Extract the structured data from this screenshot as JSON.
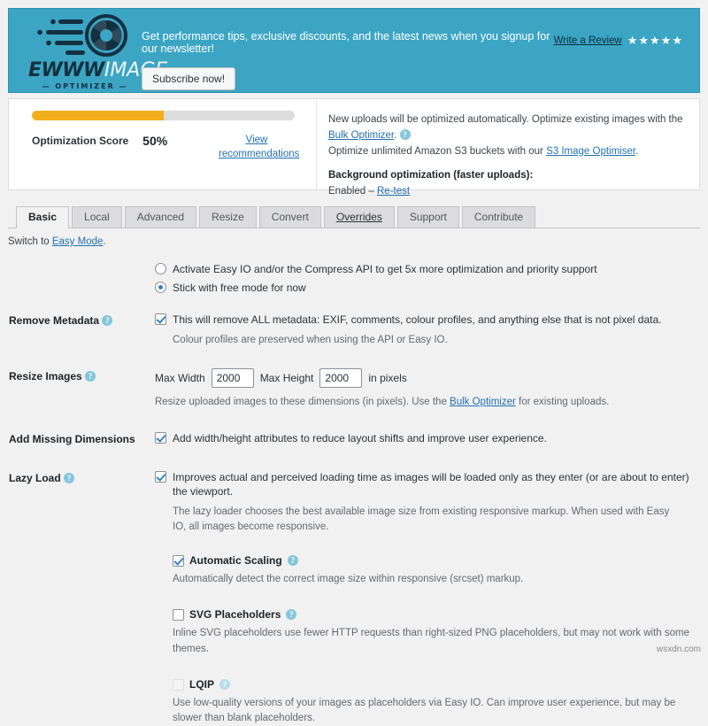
{
  "banner": {
    "logo": {
      "brand_primary": "EWWW",
      "brand_secondary": "IMAGE",
      "brand_sub": "— OPTIMIZER —"
    },
    "promo_text": "Get performance tips, exclusive discounts, and the latest news when you signup for our newsletter!",
    "subscribe_label": "Subscribe now!",
    "review_label": "Write a Review",
    "stars": "★★★★★",
    "bg_color": "#3ca5c4"
  },
  "status": {
    "progress_percent": 50,
    "score_label": "Optimization Score",
    "score_value": "50%",
    "recommendations_label": "View recommendations",
    "info_line1_a": "New uploads will be optimized automatically. Optimize existing images with the ",
    "info_line1_link": "Bulk Optimizer",
    "info_line2_a": "Optimize unlimited Amazon S3 buckets with our ",
    "info_line2_link": "S3 Image Optimiser",
    "info_line2_b": ".",
    "background_title": "Background optimization (faster uploads):",
    "background_status": "Enabled – ",
    "background_link": "Re-test",
    "progress_color": "#f2ae1c"
  },
  "tabs": [
    {
      "label": "Basic",
      "active": true
    },
    {
      "label": "Local",
      "active": false
    },
    {
      "label": "Advanced",
      "active": false
    },
    {
      "label": "Resize",
      "active": false
    },
    {
      "label": "Convert",
      "active": false
    },
    {
      "label": "Overrides",
      "active": false
    },
    {
      "label": "Support",
      "active": false
    },
    {
      "label": "Contribute",
      "active": false
    }
  ],
  "switch_mode": {
    "prefix": "Switch to ",
    "link": "Easy Mode",
    "suffix": "."
  },
  "settings": {
    "mode": {
      "option_paid": "Activate Easy IO and/or the Compress API to get 5x more optimization and priority support",
      "option_free": "Stick with free mode for now",
      "selected": "free"
    },
    "remove_metadata": {
      "label": "Remove Metadata",
      "checkbox_text": "This will remove ALL metadata: EXIF, comments, colour profiles, and anything else that is not pixel data.",
      "desc": "Colour profiles are preserved when using the API or Easy IO.",
      "checked": true
    },
    "resize_images": {
      "label": "Resize Images",
      "max_width_label": "Max Width",
      "max_width_value": "2000",
      "max_height_label": "Max Height",
      "max_height_value": "2000",
      "units": "in pixels",
      "desc_a": "Resize uploaded images to these dimensions (in pixels). Use the ",
      "desc_link": "Bulk Optimizer",
      "desc_b": " for existing uploads."
    },
    "add_missing_dimensions": {
      "label": "Add Missing Dimensions",
      "checkbox_text": "Add width/height attributes to reduce layout shifts and improve user experience.",
      "checked": true
    },
    "lazy_load": {
      "label": "Lazy Load",
      "checkbox_text": "Improves actual and perceived loading time as images will be loaded only as they enter (or are about to enter) the viewport.",
      "desc": "The lazy loader chooses the best available image size from existing responsive markup. When used with Easy IO, all images become responsive.",
      "checked": true,
      "sub_options": [
        {
          "title": "Automatic Scaling",
          "desc": "Automatically detect the correct image size within responsive (srcset) markup.",
          "checked": true,
          "disabled": false
        },
        {
          "title": "SVG Placeholders",
          "desc": "Inline SVG placeholders use fewer HTTP requests than right-sized PNG placeholders, but may not work with some themes.",
          "checked": false,
          "disabled": false
        },
        {
          "title": "LQIP",
          "desc": "Use low-quality versions of your images as placeholders via Easy IO. Can improve user experience, but may be slower than blank placeholders.",
          "checked": false,
          "disabled": true
        }
      ]
    }
  },
  "watermark": "wsxdn.com"
}
